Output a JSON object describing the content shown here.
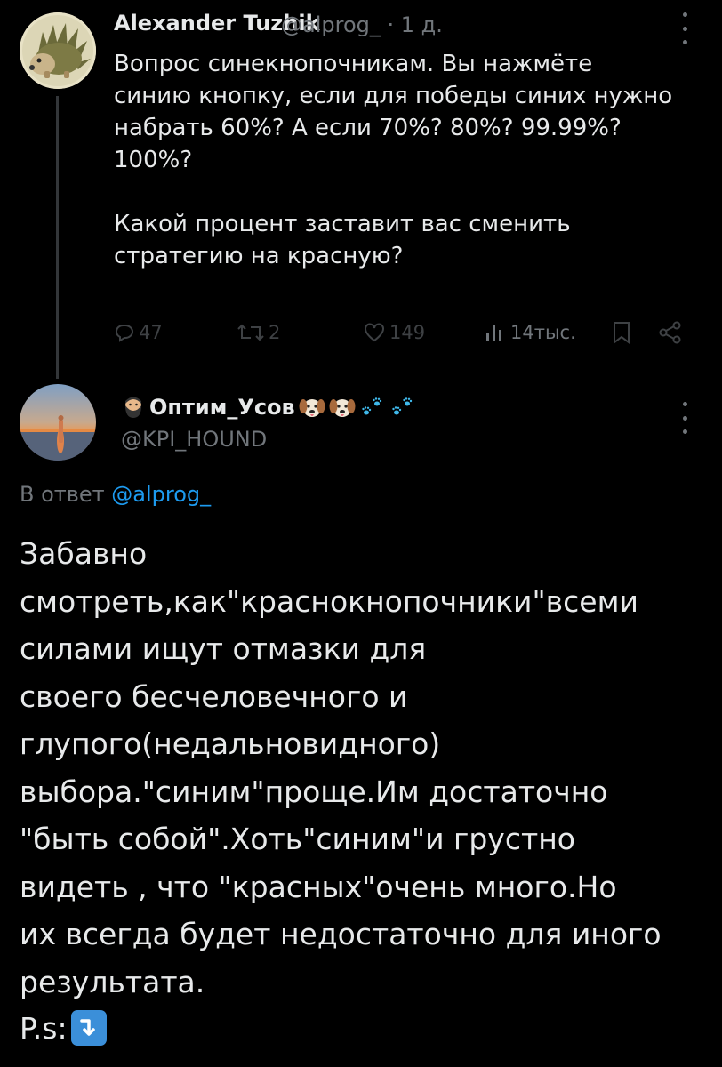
{
  "parent_tweet": {
    "author_name": "Alexander Tuzhik",
    "handle_time": "@alprog_ · 1 д.",
    "text": "Вопрос синекнопочникам. Вы нажмёте\nсинию кнопку, если для победы синих нужно\nнабрать 60%? А если 70%? 80%? 99.99%?\n100%?\n\nКакой процент заставит вас сменить\nстратегию на красную?",
    "actions": {
      "replies": "47",
      "retweets": "2",
      "likes": "149",
      "views": "14тыс."
    }
  },
  "reply_tweet": {
    "author_name": "Оптим_Усов",
    "handle": "@KPI_HOUND",
    "reply_to_label": "В ответ",
    "reply_to_mention": "@alprog_",
    "text": "Забавно\nсмотреть,как\"краснокнопочники\"всеми\nсилами ищут отмазки для\nсвоего бесчеловечного и\nглупого(недальновидного)\nвыбора.\"синим\"проще.Им достаточно\n\"быть собой\".Хоть\"синим\"и грустно\nвидеть , что \"красных\"очень много.Но\nих всегда будет недостаточно для иного\nрезультата.",
    "ps_label": "P.s:"
  },
  "colors": {
    "background": "#000000",
    "text": "#e7e9ea",
    "muted": "#71767b",
    "link": "#1d9bf0"
  },
  "icons": [
    "hedgehog-avatar",
    "sunset-avatar",
    "bearded-man-emoji",
    "dog-face-emoji",
    "paw-prints-emoji",
    "more-icon",
    "reply-icon",
    "retweet-icon",
    "like-icon",
    "views-icon",
    "bookmark-icon",
    "share-icon",
    "down-arrow-emoji"
  ]
}
